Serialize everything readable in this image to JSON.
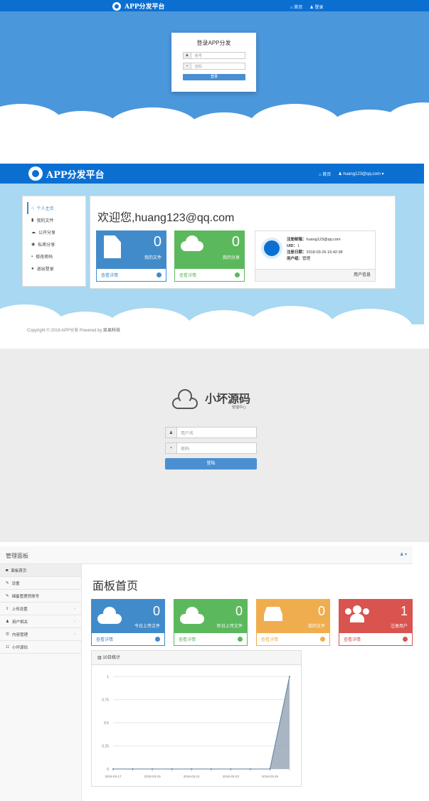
{
  "s1": {
    "brand": "APP分发平台",
    "nav": {
      "home": "首页",
      "login": "登录"
    },
    "title": "登录APP分发",
    "user_ph": "账号",
    "pass_ph": "密码",
    "submit": "登录"
  },
  "s2": {
    "brand": "APP分发平台",
    "nav": {
      "home": "首页",
      "user": "huang123@qq.com"
    },
    "sidebar": [
      "个人主页",
      "我的文件",
      "公开分享",
      "私密分享",
      "修改密码",
      "退出登录"
    ],
    "welcome": "欢迎您,huang123@qq.com",
    "stats": [
      {
        "num": "0",
        "label": "我的文件",
        "link": "查看详情"
      },
      {
        "num": "0",
        "label": "我的分享",
        "link": "查看详情"
      }
    ],
    "info": {
      "email_label": "注册邮箱：",
      "email": "huang123@qq.com",
      "uid_label": "UID：",
      "uid": "1",
      "date_label": "注册日期：",
      "date": "2018-03-26 15:42:38",
      "group_label": "用户组：",
      "group": "管理",
      "link": "用户信息"
    },
    "footer": {
      "copyright": "Copyright © 2016 APP分发 Powered by ",
      "company": "凯易科技"
    }
  },
  "s3": {
    "brand": "小坏源码",
    "sub": "管理中心",
    "user_ph": "用户名",
    "pass_ph": "密码",
    "submit": "登陆"
  },
  "s4": {
    "title": "管理面板",
    "menu": [
      "面板首页",
      "设置",
      "储备管理员账号",
      "上传设置",
      "用户相关",
      "内容管理",
      "小坏源码"
    ],
    "heading": "面板首页",
    "stats": [
      {
        "num": "0",
        "label": "今日上传文件",
        "link": "查看详情",
        "color": "#428bca"
      },
      {
        "num": "0",
        "label": "昨日上传文件",
        "link": "查看详情",
        "color": "#5cb85c"
      },
      {
        "num": "0",
        "label": "我的文件",
        "link": "查看详情",
        "color": "#f0ad4e"
      },
      {
        "num": "1",
        "label": "注册用户",
        "link": "查看详情",
        "color": "#d9534f"
      }
    ],
    "chart_title": "10日统计"
  },
  "chart_data": {
    "type": "area",
    "title": "10日统计",
    "x": [
      "2018-03-17",
      "2018-03-18",
      "2018-03-19",
      "2018-03-20",
      "2018-03-21",
      "2018-03-22",
      "2018-03-23",
      "2018-03-24",
      "2018-03-25",
      "2018-03-26"
    ],
    "tick_labels": [
      "2018-03-17",
      "2018-03-19",
      "2018-03-21",
      "2018-03-23",
      "2018-03-25"
    ],
    "values": [
      0,
      0,
      0,
      0,
      0,
      0,
      0,
      0,
      0,
      1
    ],
    "y_ticks": [
      "0",
      "0.25",
      "0.5",
      "0.75",
      "1"
    ],
    "ylim": [
      0,
      1
    ],
    "grid": true,
    "color": "#9aa8b8"
  }
}
